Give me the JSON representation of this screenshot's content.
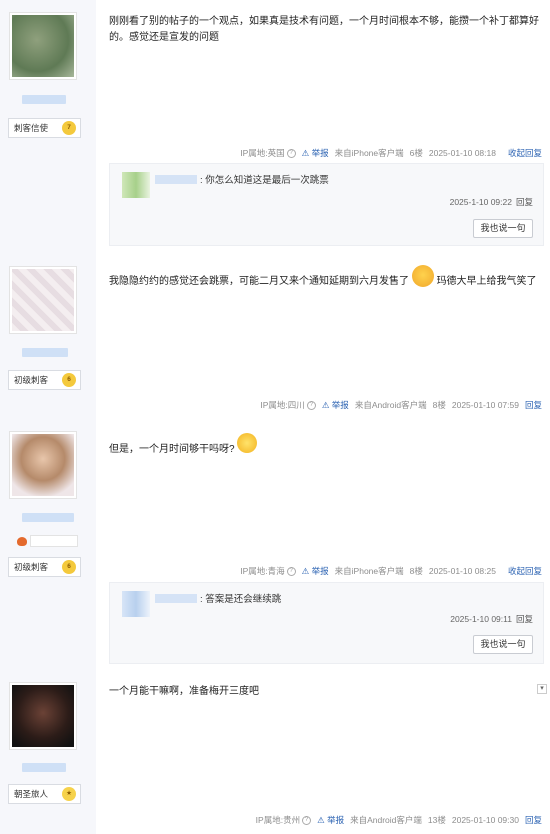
{
  "posts": [
    {
      "content": "刚刚看了别的帖子的一个观点，如果真是技术有问题，一个月时间根本不够，能攒一个补丁都算好的。感觉还是宣发的问题",
      "badge": "刺客信使",
      "level": "7",
      "meta": {
        "ip": "IP属地:英国",
        "report": "举报",
        "source": "来自iPhone客户端",
        "floor": "6楼",
        "time": "2025-01-10 08:18",
        "collapse": "收起回复"
      },
      "reply": {
        "text": ": 你怎么知道这是最后一次跳票",
        "time": "2025-1-10 09:22",
        "reply": "回复",
        "say": "我也说一句"
      }
    },
    {
      "content_a": "我隐隐约约的感觉还会跳票，可能二月又来个通知延期到六月发售了",
      "content_b": "玛德大早上给我气笑了",
      "badge": "初级刺客",
      "level": "6",
      "meta": {
        "ip": "IP属地:四川",
        "report": "举报",
        "source": "来自Android客户端",
        "floor": "8楼",
        "time": "2025-01-10 07:59",
        "reply": "回复"
      }
    },
    {
      "content": "但是，一个月时间够干吗呀?",
      "badge": "初级刺客",
      "level": "6",
      "meta": {
        "ip": "IP属地:青海",
        "report": "举报",
        "source": "来自iPhone客户端",
        "floor": "8楼",
        "time": "2025-01-10 08:25",
        "collapse": "收起回复"
      },
      "reply": {
        "text": ": 答案是还会继续跳",
        "time": "2025-1-10 09:11",
        "reply": "回复",
        "say": "我也说一句"
      }
    },
    {
      "content": "一个月能干嘛啊，准备梅开三度吧",
      "badge": "朝圣旅人",
      "level": "",
      "meta": {
        "ip": "IP属地:贵州",
        "report": "举报",
        "source": "来自Android客户端",
        "floor": "13楼",
        "time": "2025-01-10 09:30",
        "reply": "回复"
      }
    }
  ],
  "colors": {
    "link": "#2d64b3",
    "badge_star": "#f4c93c",
    "sidebar": "#f6f7fb"
  },
  "icons": {
    "help": "?",
    "report": "warning-icon"
  }
}
